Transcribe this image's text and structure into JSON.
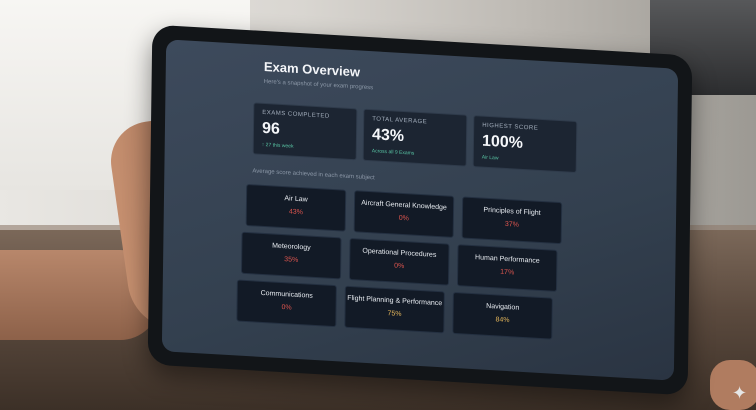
{
  "dashboard": {
    "title": "Exam Overview",
    "subtitle": "Here's a snapshot of your exam progress",
    "stats": [
      {
        "label": "Exams Completed",
        "value": "96",
        "note": "↑ 27 this week"
      },
      {
        "label": "Total Average",
        "value": "43%",
        "note": "Across all 9 Exams"
      },
      {
        "label": "Highest Score",
        "value": "100%",
        "note": "Air Law"
      }
    ],
    "section_label": "Average score achieved in each exam subject",
    "subjects": [
      {
        "name": "Air Law",
        "score": "43%",
        "color": "#e0564f"
      },
      {
        "name": "Aircraft General Knowledge",
        "score": "0%",
        "color": "#e0564f"
      },
      {
        "name": "Principles of Flight",
        "score": "37%",
        "color": "#e0564f"
      },
      {
        "name": "Meteorology",
        "score": "35%",
        "color": "#e0564f"
      },
      {
        "name": "Operational Procedures",
        "score": "0%",
        "color": "#e0564f"
      },
      {
        "name": "Human Performance",
        "score": "17%",
        "color": "#e0564f"
      },
      {
        "name": "Communications",
        "score": "0%",
        "color": "#e0564f"
      },
      {
        "name": "Flight Planning & Performance",
        "score": "75%",
        "color": "#e3b55a"
      },
      {
        "name": "Navigation",
        "score": "84%",
        "color": "#e3b55a"
      }
    ]
  },
  "icons": {
    "corner": "sparkle-icon"
  }
}
